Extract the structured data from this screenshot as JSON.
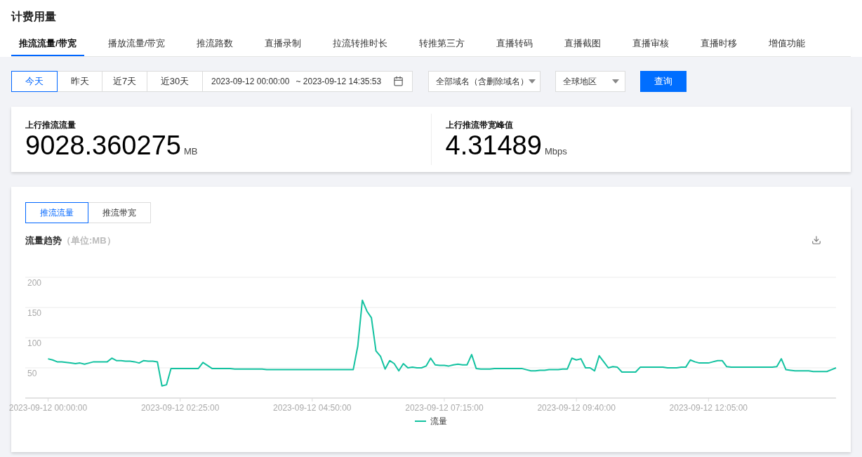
{
  "page_title": "计费用量",
  "tabs": [
    {
      "label": "推流流量/带宽",
      "selected": true
    },
    {
      "label": "播放流量/带宽",
      "selected": false
    },
    {
      "label": "推流路数",
      "selected": false
    },
    {
      "label": "直播录制",
      "selected": false
    },
    {
      "label": "拉流转推时长",
      "selected": false
    },
    {
      "label": "转推第三方",
      "selected": false
    },
    {
      "label": "直播转码",
      "selected": false
    },
    {
      "label": "直播截图",
      "selected": false
    },
    {
      "label": "直播审核",
      "selected": false
    },
    {
      "label": "直播时移",
      "selected": false
    },
    {
      "label": "增值功能",
      "selected": false
    }
  ],
  "filters": {
    "ranges": [
      {
        "label": "今天",
        "selected": true
      },
      {
        "label": "昨天",
        "selected": false
      },
      {
        "label": "近7天",
        "selected": false
      },
      {
        "label": "近30天",
        "selected": false
      }
    ],
    "date_start": "2023-09-12 00:00:00",
    "date_end": "~ 2023-09-12 14:35:53",
    "domain": "全部域名（含删除域名）",
    "region": "全球地区",
    "query_button": "查询"
  },
  "stats": [
    {
      "label": "上行推流流量",
      "value": "9028.360275",
      "unit": "MB"
    },
    {
      "label": "上行推流带宽峰值",
      "value": "4.31489",
      "unit": "Mbps"
    }
  ],
  "chart_panel": {
    "toggles": [
      {
        "label": "推流流量",
        "selected": true
      },
      {
        "label": "推流带宽",
        "selected": false
      }
    ],
    "title": "流量趋势",
    "unit_note": "（单位:MB）",
    "chart_data": {
      "type": "line",
      "grid": true,
      "ylim": [
        0,
        200
      ],
      "yticks": [
        50,
        100,
        150,
        200
      ],
      "categories": [
        "2023-09-12 00:00:00",
        null,
        null,
        null,
        null,
        null,
        null,
        null,
        null,
        null,
        null,
        null,
        null,
        null,
        null,
        null,
        null,
        null,
        null,
        null,
        null,
        null,
        null,
        null,
        null,
        null,
        null,
        null,
        null,
        "2023-09-12 02:25:00",
        null,
        null,
        null,
        null,
        null,
        null,
        null,
        null,
        null,
        null,
        null,
        null,
        null,
        null,
        null,
        null,
        null,
        null,
        null,
        null,
        null,
        null,
        null,
        null,
        null,
        null,
        null,
        null,
        "2023-09-12 04:50:00",
        null,
        null,
        null,
        null,
        null,
        null,
        null,
        null,
        null,
        null,
        null,
        null,
        null,
        null,
        null,
        null,
        null,
        null,
        null,
        null,
        null,
        null,
        null,
        null,
        null,
        null,
        null,
        null,
        "2023-09-12 07:15:00",
        null,
        null,
        null,
        null,
        null,
        null,
        null,
        null,
        null,
        null,
        null,
        null,
        null,
        null,
        null,
        null,
        null,
        null,
        null,
        null,
        null,
        null,
        null,
        null,
        null,
        null,
        null,
        null,
        "2023-09-12 09:40:00",
        null,
        null,
        null,
        null,
        null,
        null,
        null,
        null,
        null,
        null,
        null,
        null,
        null,
        null,
        null,
        null,
        null,
        null,
        null,
        null,
        null,
        null,
        null,
        null,
        null,
        null,
        null,
        null,
        "2023-09-12 12:05:00",
        null,
        null,
        null,
        null,
        null,
        null,
        null,
        null,
        null,
        null,
        null,
        null,
        null,
        null,
        null,
        null,
        null,
        null,
        null,
        null,
        null,
        null,
        null,
        null,
        null,
        null,
        null,
        null
      ],
      "series": [
        {
          "name": "流量",
          "color": "#13c2a0",
          "values": [
            65,
            63,
            60,
            60,
            59,
            58,
            57,
            58,
            56,
            58,
            60,
            60,
            60,
            60,
            66,
            62,
            62,
            61,
            61,
            60,
            58,
            62,
            61,
            61,
            60,
            20,
            22,
            49,
            49,
            49,
            49,
            49,
            49,
            49,
            59,
            54,
            49,
            49,
            49,
            49,
            49,
            48,
            48,
            48,
            48,
            48,
            48,
            48,
            47,
            47,
            47,
            47,
            47,
            47,
            47,
            47,
            47,
            47,
            47,
            47,
            47,
            47,
            47,
            47,
            47,
            47,
            47,
            47,
            86,
            162,
            144,
            133,
            78,
            69,
            48,
            62,
            57,
            45,
            57,
            50,
            51,
            50,
            50,
            53,
            66,
            55,
            54,
            54,
            53,
            55,
            56,
            55,
            55,
            72,
            49,
            48,
            48,
            48,
            49,
            49,
            49,
            49,
            49,
            49,
            49,
            47,
            45,
            45,
            46,
            46,
            47,
            47,
            47,
            48,
            48,
            66,
            63,
            65,
            50,
            50,
            45,
            70,
            60,
            50,
            52,
            51,
            43,
            43,
            43,
            43,
            51,
            51,
            51,
            51,
            51,
            51,
            50,
            50,
            50,
            51,
            51,
            63,
            60,
            58,
            58,
            58,
            60,
            62,
            62,
            52,
            51,
            51,
            51,
            51,
            51,
            51,
            51,
            51,
            51,
            51,
            52,
            65,
            47,
            46,
            45,
            45,
            45,
            45,
            44,
            44,
            44,
            44,
            47,
            50
          ]
        }
      ]
    }
  }
}
